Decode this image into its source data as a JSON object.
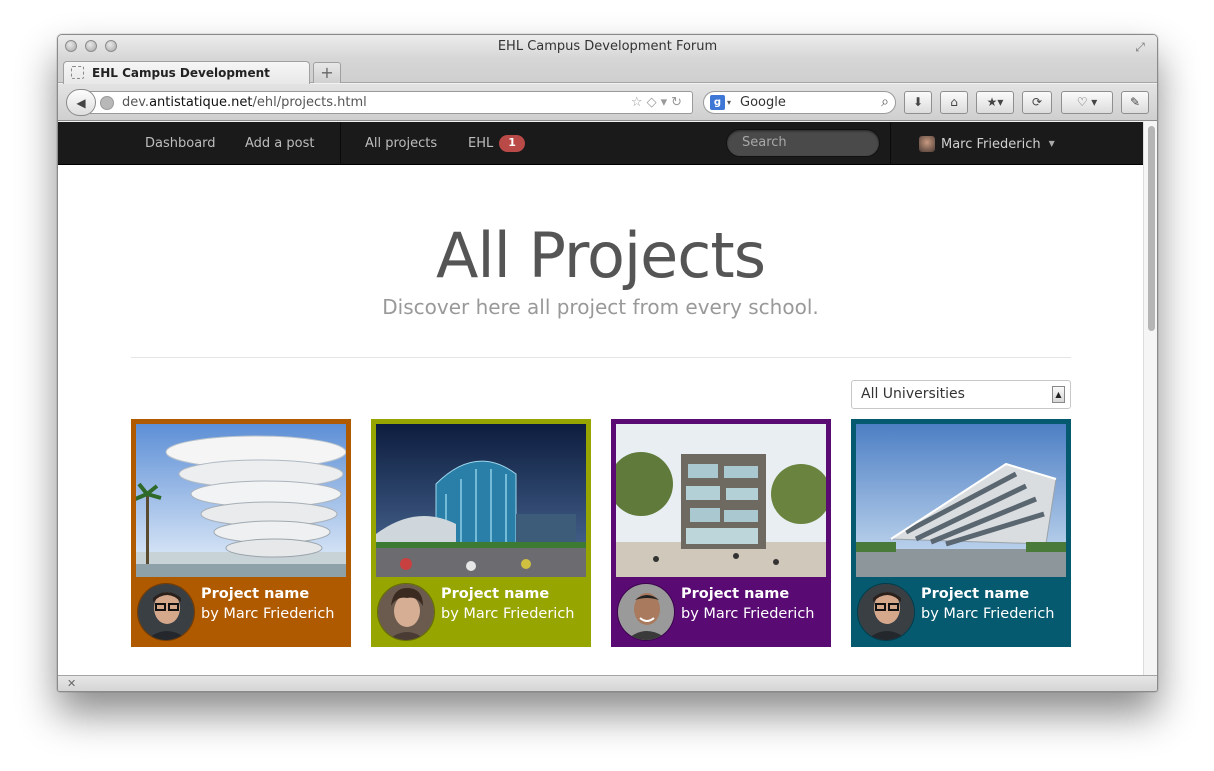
{
  "window": {
    "title": "EHL Campus Development Forum",
    "tab_title": "EHL Campus Development Forum",
    "url_prefix": "dev.",
    "url_host": "antistatique.net",
    "url_path": "/ehl/projects.html",
    "search_engine": "Google",
    "status_glyph": "✕"
  },
  "navbar": {
    "items": [
      "Dashboard",
      "Add a post",
      "All projects",
      "EHL"
    ],
    "ehl_badge": "1",
    "search_placeholder": "Search",
    "user_name": "Marc Friederich"
  },
  "hero": {
    "title": "All Projects",
    "subtitle": "Discover here all project from every school."
  },
  "filter": {
    "selected": "All Universities"
  },
  "projects": [
    {
      "title": "Project name",
      "author": "by Marc Friederich",
      "color": "#b05a00"
    },
    {
      "title": "Project name",
      "author": "by Marc Friederich",
      "color": "#97a500"
    },
    {
      "title": "Project name",
      "author": "by Marc Friederich",
      "color": "#5a0a73"
    },
    {
      "title": "Project name",
      "author": "by Marc Friederich",
      "color": "#055a70"
    }
  ],
  "colors": {
    "navbar": "#1a1a1a",
    "badge": "#b94a48"
  }
}
